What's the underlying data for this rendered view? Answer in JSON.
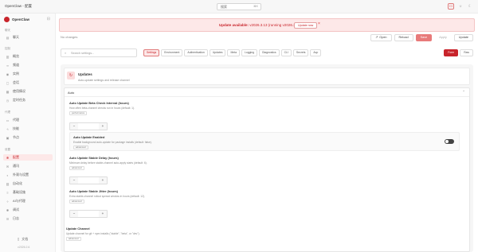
{
  "app": {
    "title": "OpenClaw - 配置"
  },
  "titlebar": {
    "search_label": "搜索",
    "search_kbd": "⌘K"
  },
  "sidebar": {
    "brand": "OpenClaw",
    "sections": [
      {
        "label": "聊天",
        "items": [
          {
            "label": "聊天",
            "icon": "chat-icon"
          }
        ]
      },
      {
        "label": "控制",
        "items": [
          {
            "label": "概览",
            "icon": "chart-icon"
          },
          {
            "label": "频道",
            "icon": "link-icon"
          },
          {
            "label": "实例",
            "icon": "radio-icon"
          },
          {
            "label": "会话",
            "icon": "file-icon"
          },
          {
            "label": "使用情况",
            "icon": "bar-icon"
          },
          {
            "label": "定时任务",
            "icon": "clock-icon"
          }
        ]
      },
      {
        "label": "代理",
        "items": [
          {
            "label": "代理",
            "icon": "folder-icon"
          },
          {
            "label": "技能",
            "icon": "bolt-icon"
          },
          {
            "label": "节点",
            "icon": "monitor-icon"
          }
        ]
      },
      {
        "label": "设置",
        "items": [
          {
            "label": "配置",
            "icon": "gear-icon",
            "active": true
          },
          {
            "label": "通讯",
            "icon": "message-icon"
          },
          {
            "label": "外观与设置",
            "icon": "palette-icon"
          },
          {
            "label": "自动化",
            "icon": "robot-icon"
          },
          {
            "label": "基础设施",
            "icon": "server-icon"
          },
          {
            "label": "AI与代理",
            "icon": "brain-icon"
          },
          {
            "label": "调试",
            "icon": "bug-icon"
          },
          {
            "label": "日志",
            "icon": "log-icon"
          }
        ]
      }
    ],
    "docs": "文档",
    "version": "v2026.2.6"
  },
  "banner": {
    "text_strong": "Update available:",
    "text_rest": "v2026.3.13 (running v2026.3.12).",
    "button": "Update now"
  },
  "status": "No changes",
  "actions": {
    "open": "Open",
    "reload": "Reload",
    "save": "Save",
    "apply": "Apply",
    "update": "Update"
  },
  "search": {
    "placeholder": "Search settings..."
  },
  "tabs": [
    "Settings",
    "Environment",
    "Authentication",
    "Updates",
    "Meta",
    "Logging",
    "Diagnostics",
    "CLI",
    "Secrets",
    "Acp"
  ],
  "modes": [
    "Form",
    "Raw"
  ],
  "section": {
    "title": "Updates",
    "subtitle": "Auto-update settings and release channel"
  },
  "card": {
    "label": "Auto"
  },
  "fields": {
    "beta": {
      "label": "Auto Update Beta Check Interval (hours)",
      "help": "How often beta-channel checks run in hours (default: 1).",
      "tag": "performance"
    },
    "enabled": {
      "label": "Auto Update Enabled",
      "help": "Enable background auto-update for package installs (default: false).",
      "tag": "advanced",
      "value": false
    },
    "stable_delay": {
      "label": "Auto Update Stable Delay (hours)",
      "help": "Minimum delay before stable-channel auto-apply starts (default: 6).",
      "tag": "advanced"
    },
    "stable_jitter": {
      "label": "Auto Update Stable Jitter (hours)",
      "help": "Extra stable-channel rollout spread window in hours (default: 12).",
      "tag": "advanced"
    },
    "channel": {
      "label": "Update Channel",
      "help": "Update channel for git + npm installs (\"stable\", \"beta\", or \"dev\").",
      "tag": "advanced"
    }
  }
}
